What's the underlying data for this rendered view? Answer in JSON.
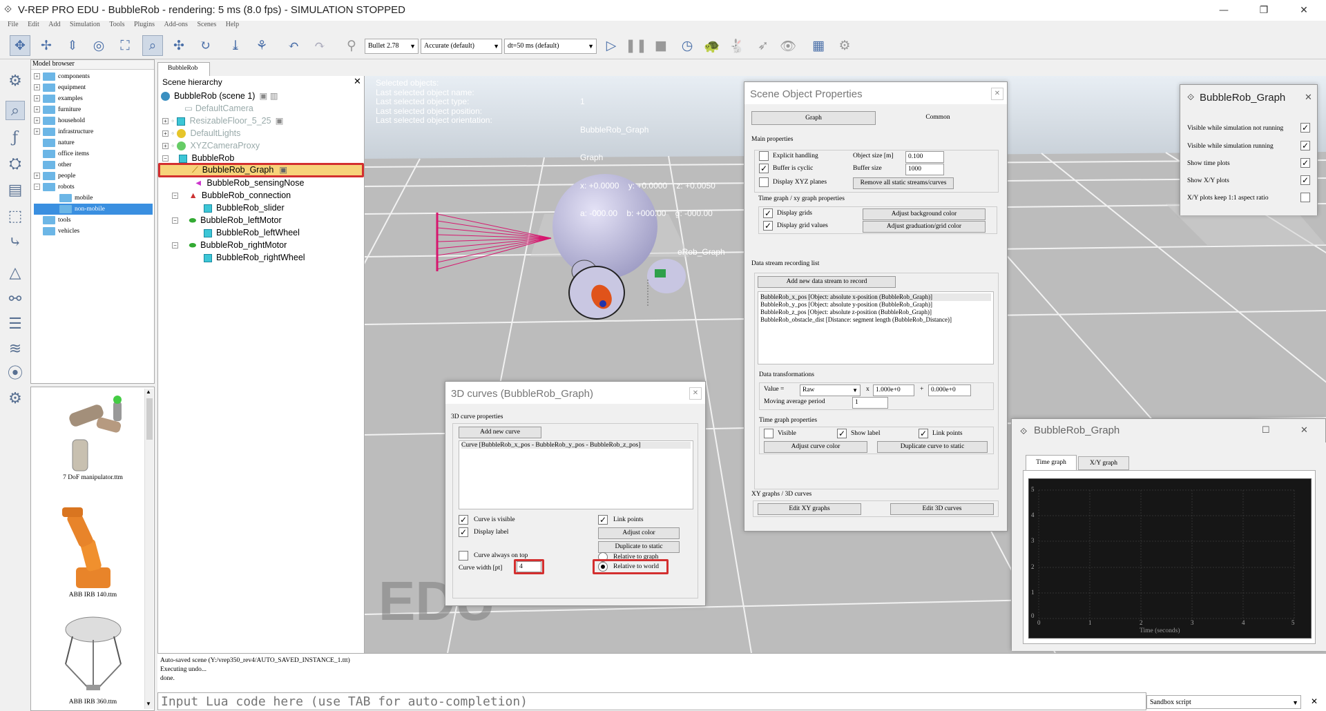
{
  "window": {
    "title": "V-REP PRO EDU - BubbleRob - rendering: 5 ms (8.0 fps) - SIMULATION STOPPED"
  },
  "menu": [
    "File",
    "Edit",
    "Add",
    "Simulation",
    "Tools",
    "Plugins",
    "Add-ons",
    "Scenes",
    "Help"
  ],
  "toolbar": {
    "engine": "Bullet 2.78",
    "accuracy": "Accurate (default)",
    "dt": "dt=50 ms (default)"
  },
  "model_browser": {
    "title": "Model browser",
    "items": [
      {
        "label": "components",
        "exp": "+"
      },
      {
        "label": "equipment",
        "exp": "+"
      },
      {
        "label": "examples",
        "exp": "+"
      },
      {
        "label": "furniture",
        "exp": "+"
      },
      {
        "label": "household",
        "exp": "+"
      },
      {
        "label": "infrastructure",
        "exp": "+"
      },
      {
        "label": "nature",
        "exp": ""
      },
      {
        "label": "office items",
        "exp": ""
      },
      {
        "label": "other",
        "exp": ""
      },
      {
        "label": "people",
        "exp": "+"
      },
      {
        "label": "robots",
        "exp": "−"
      },
      {
        "label": "mobile",
        "exp": ""
      },
      {
        "label": "non-mobile",
        "exp": ""
      },
      {
        "label": "tools",
        "exp": ""
      },
      {
        "label": "vehicles",
        "exp": ""
      }
    ],
    "thumbs": [
      "7 DoF manipulator.ttm",
      "ABB IRB 140.ttm",
      "ABB IRB 360.ttm"
    ]
  },
  "tab": "BubbleRob",
  "hierarchy": {
    "title": "Scene hierarchy",
    "items": [
      "BubbleRob (scene 1)",
      "DefaultCamera",
      "ResizableFloor_5_25",
      "DefaultLights",
      "XYZCameraProxy",
      "BubbleRob",
      "BubbleRob_Graph",
      "BubbleRob_sensingNose",
      "BubbleRob_connection",
      "BubbleRob_slider",
      "BubbleRob_leftMotor",
      "BubbleRob_leftWheel",
      "BubbleRob_rightMotor",
      "BubbleRob_rightWheel"
    ]
  },
  "overlay": {
    "labels": [
      "Selected objects:",
      "Last selected object name:",
      "Last selected object type:",
      "Last selected object position:",
      "Last selected object orientation:"
    ],
    "values": [
      "1",
      "BubbleRob_Graph",
      "Graph",
      "x: +0.0000    y: +0.0000    z: +0.0050",
      "a: -000.00    b: +000.00    g: -000.00"
    ],
    "graph_label": "eRob_Graph",
    "edu": "EDU"
  },
  "sop": {
    "title": "Scene Object Properties",
    "tab_graph": "Graph",
    "tab_common": "Common",
    "main": "Main properties",
    "explicit": "Explicit handling",
    "buffer_cyclic": "Buffer is cyclic",
    "display_xyz": "Display XYZ planes",
    "object_size": "Object size [m]",
    "object_size_val": "0.100",
    "buffer_size": "Buffer size",
    "buffer_size_val": "1000",
    "remove_static": "Remove all static streams/curves",
    "timegraph_props": "Time graph / xy graph properties",
    "display_grids": "Display grids",
    "display_grid_values": "Display grid values",
    "adjust_bg": "Adjust background color",
    "adjust_grad": "Adjust graduation/grid color",
    "stream_list": "Data stream recording list",
    "add_stream": "Add new data stream to record",
    "streams": [
      "BubbleRob_x_pos [Object: absolute x-position (BubbleRob_Graph)]",
      "BubbleRob_y_pos [Object: absolute y-position (BubbleRob_Graph)]",
      "BubbleRob_z_pos [Object: absolute z-position (BubbleRob_Graph)]",
      "BubbleRob_obstacle_dist [Distance: segment length (BubbleRob_Distance)]"
    ],
    "transforms": "Data transformations",
    "value": "Value =",
    "raw": "Raw",
    "x": "x",
    "mult": "1.000e+0",
    "plus": "+",
    "add": "0.000e+0",
    "moving": "Moving average period",
    "moving_val": "1",
    "tg_props": "Time graph properties",
    "visible": "Visible",
    "show_label": "Show label",
    "link_points": "Link points",
    "adjust_curve": "Adjust curve color",
    "dup_curve": "Duplicate curve to static",
    "xy3d": "XY graphs / 3D curves",
    "edit_xy": "Edit XY graphs",
    "edit_3d": "Edit 3D curves"
  },
  "curves": {
    "title": "3D curves (BubbleRob_Graph)",
    "props": "3D curve properties",
    "add": "Add new curve",
    "item": "Curve [BubbleRob_x_pos - BubbleRob_y_pos - BubbleRob_z_pos]",
    "visible": "Curve is visible",
    "display_label": "Display label",
    "link": "Link points",
    "adjust": "Adjust color",
    "dup": "Duplicate to static",
    "on_top": "Curve always on top",
    "rel_graph": "Relative to graph",
    "rel_world": "Relative to world",
    "width_lbl": "Curve width [pt]",
    "width_val": "4"
  },
  "graph_opts": {
    "title": "BubbleRob_Graph",
    "items": [
      "Visible while simulation not running",
      "Visible while simulation running",
      "Show time plots",
      "Show X/Y plots",
      "X/Y plots keep 1:1 aspect ratio"
    ],
    "checked": [
      true,
      true,
      true,
      true,
      false
    ]
  },
  "graph_win": {
    "title": "BubbleRob_Graph",
    "tab1": "Time graph",
    "tab2": "X/Y graph",
    "xlabel": "Time (seconds)",
    "xticks": [
      "0",
      "1",
      "2",
      "3",
      "4",
      "5"
    ],
    "yticks": [
      "5",
      "4",
      "3",
      "2",
      "1",
      "0"
    ]
  },
  "console": {
    "lines": [
      "Auto-saved scene (Y:/vrep350_rev4/AUTO_SAVED_INSTANCE_1.ttt)",
      "Executing undo...",
      "done."
    ],
    "placeholder": "Input Lua code here (use TAB for auto-completion)",
    "script": "Sandbox script"
  }
}
